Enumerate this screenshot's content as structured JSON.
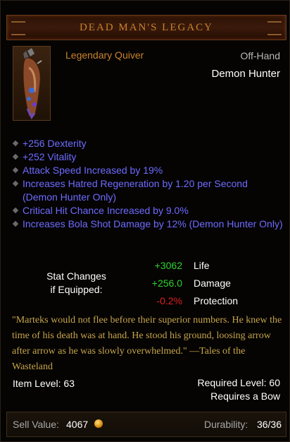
{
  "item": {
    "name": "DEAD MAN'S LEGACY",
    "type": "Legendary Quiver",
    "slot": "Off-Hand",
    "class": "Demon Hunter",
    "icon": "quiver-icon"
  },
  "affixes": [
    "+256 Dexterity",
    "+252 Vitality",
    "Attack Speed Increased by 19%",
    "Increases Hatred Regeneration by 1.20 per Second (Demon Hunter Only)",
    "Critical Hit Chance Increased by 9.0%",
    "Increases Bola Shot Damage by 12% (Demon Hunter Only)"
  ],
  "stat_changes": {
    "label_line1": "Stat Changes",
    "label_line2": "if Equipped:",
    "rows": [
      {
        "value": "+3062",
        "name": "Life",
        "color": "#2fd12f"
      },
      {
        "value": "+256.0",
        "name": "Damage",
        "color": "#2fd12f"
      },
      {
        "value": "-0.2%",
        "name": "Protection",
        "color": "#e02020"
      }
    ]
  },
  "flavor_text": "\"Marteks would not flee before their superior numbers. He knew the time of his death was at hand. He stood his ground, loosing arrow after arrow as he was slowly overwhelmed.\" —Tales of the Wasteland",
  "requirements": {
    "item_level": "Item Level: 63",
    "required_level": "Required Level: 60",
    "requires": "Requires a Bow"
  },
  "footer": {
    "sell_label": "Sell Value:",
    "sell_value": "4067",
    "durability_label": "Durability:",
    "durability_value": "36/36"
  },
  "colors": {
    "title": "#c9822e",
    "affix": "#6e6bff",
    "flavor": "#c8a54a"
  }
}
